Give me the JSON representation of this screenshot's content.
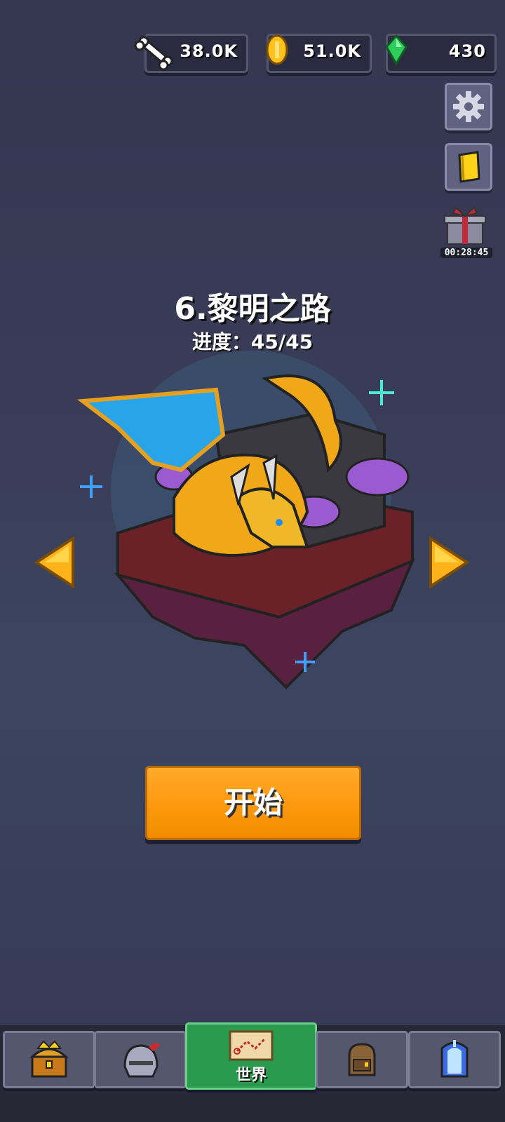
{
  "resources": {
    "bones": "38.0K",
    "coins": "51.0K",
    "gems": "430"
  },
  "gift_timer": "00:28:45",
  "stage": {
    "title": "6.黎明之路",
    "progress": "进度：45/45"
  },
  "start_button": "开始",
  "nav": {
    "tabs": [
      {
        "icon": "treasure-chest-icon",
        "label": ""
      },
      {
        "icon": "knight-helmet-icon",
        "label": ""
      },
      {
        "icon": "world-map-icon",
        "label": "世界"
      },
      {
        "icon": "backpack-icon",
        "label": ""
      },
      {
        "icon": "crystal-portal-icon",
        "label": ""
      }
    ],
    "active_index": 2
  },
  "colors": {
    "accent_orange": "#ff9a10",
    "active_tab": "#2a9a4c",
    "background": "#3a3d58"
  }
}
